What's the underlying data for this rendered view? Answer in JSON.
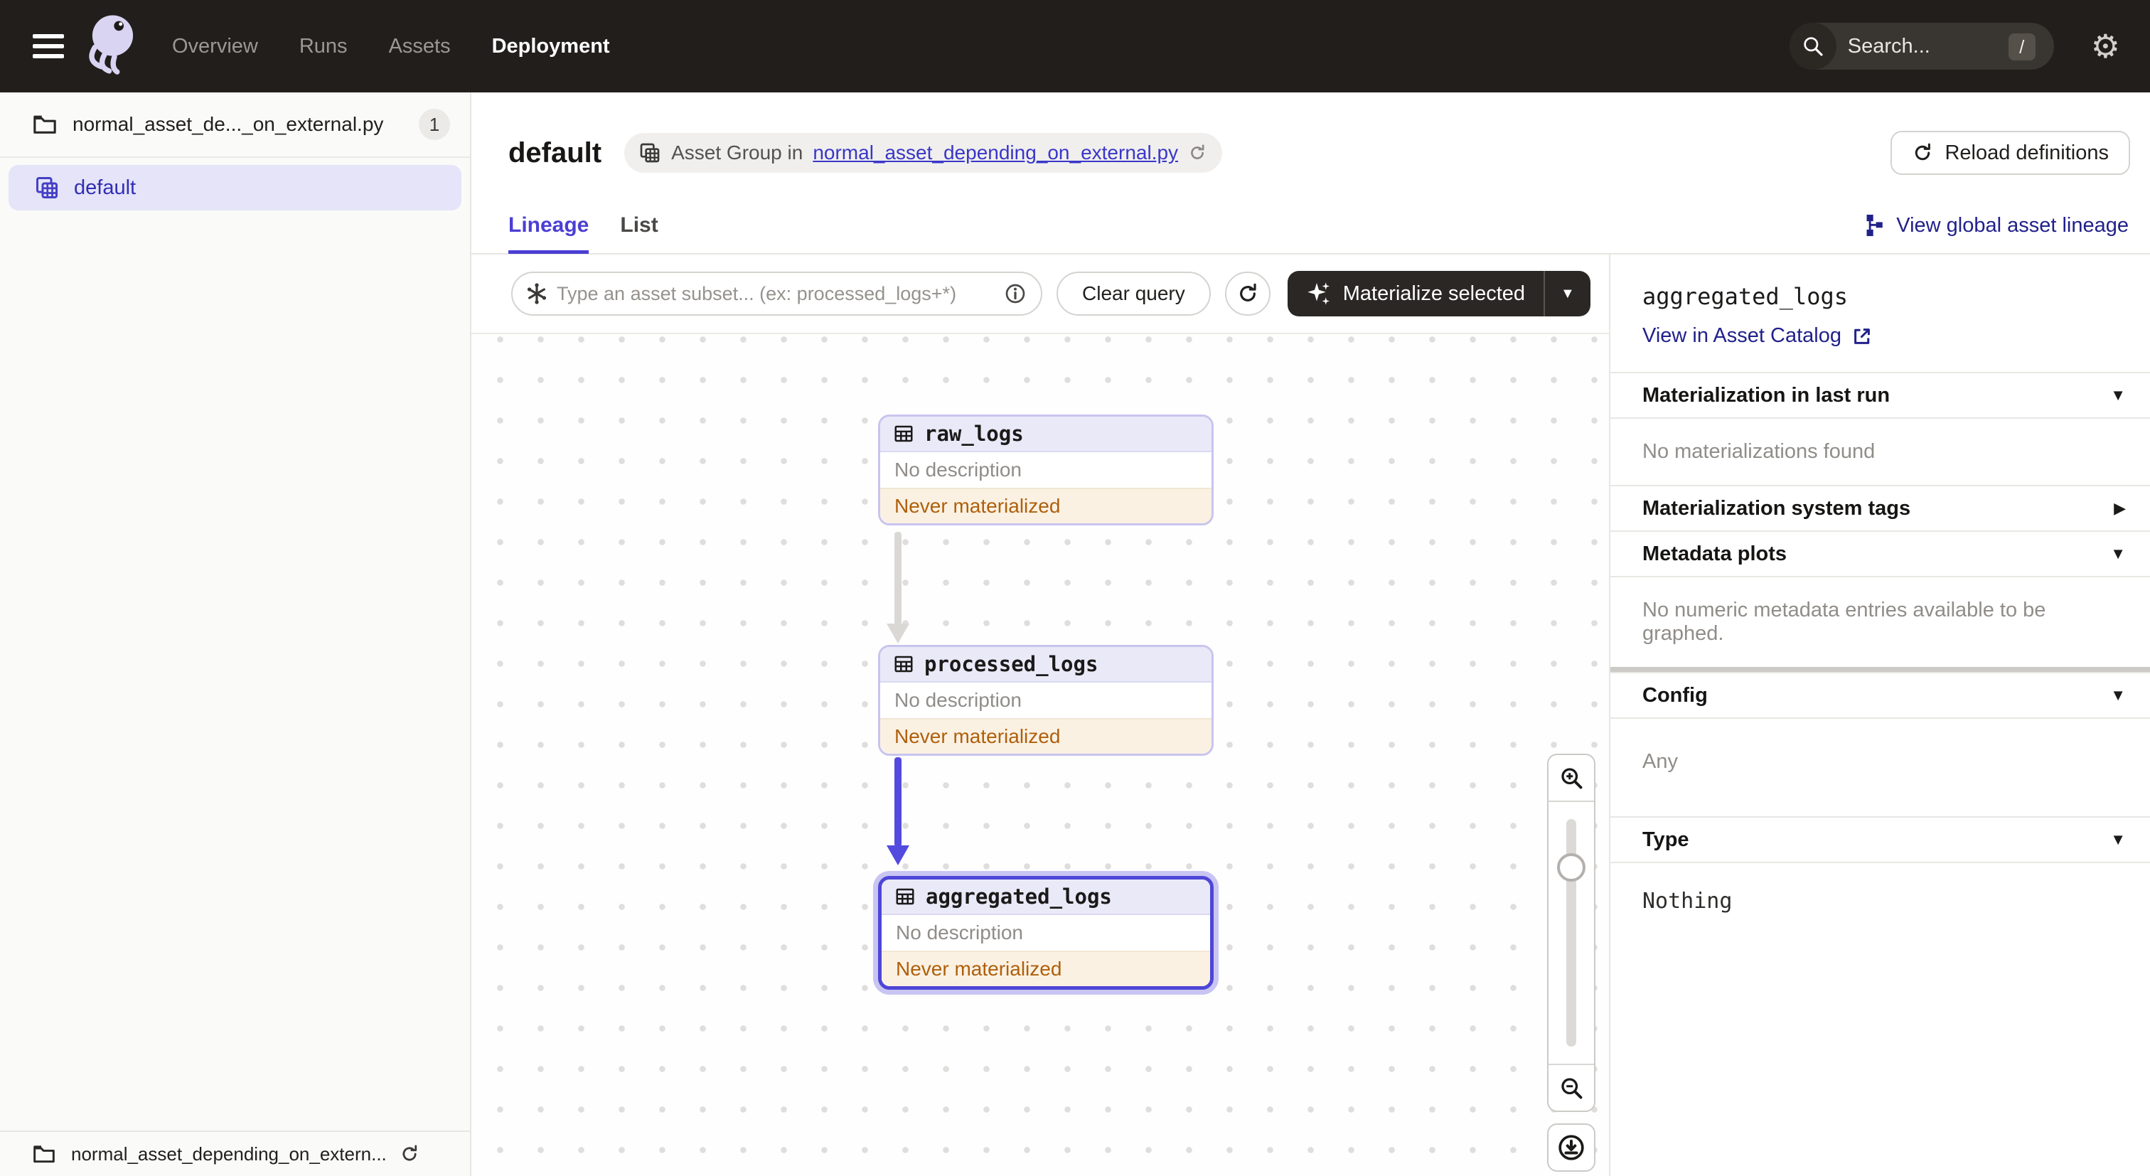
{
  "nav": {
    "links": [
      {
        "label": "Overview"
      },
      {
        "label": "Runs"
      },
      {
        "label": "Assets"
      },
      {
        "label": "Deployment"
      }
    ],
    "active": "Deployment",
    "search": {
      "placeholder": "Search...",
      "shortcut": "/"
    }
  },
  "sidebar": {
    "module": {
      "label": "normal_asset_de..._on_external.py",
      "badge": "1"
    },
    "items": [
      {
        "label": "default",
        "selected": true
      }
    ],
    "footer": {
      "label": "normal_asset_depending_on_extern..."
    }
  },
  "header": {
    "title": "default",
    "breadcrumb": {
      "prefix": "Asset Group in",
      "link": "normal_asset_depending_on_external.py"
    },
    "reload_label": "Reload definitions"
  },
  "tabs": {
    "lineage": "Lineage",
    "list": "List",
    "global_lineage_label": "View global asset lineage"
  },
  "toolbar": {
    "query_placeholder": "Type an asset subset... (ex: processed_logs+*)",
    "clear_label": "Clear query",
    "materialize_label": "Materialize selected"
  },
  "graph": {
    "nodes": [
      {
        "name": "raw_logs",
        "description": "No description",
        "status": "Never materialized",
        "selected": false
      },
      {
        "name": "processed_logs",
        "description": "No description",
        "status": "Never materialized",
        "selected": false
      },
      {
        "name": "aggregated_logs",
        "description": "No description",
        "status": "Never materialized",
        "selected": true
      }
    ],
    "edges": [
      {
        "from": "raw_logs",
        "to": "processed_logs",
        "highlighted": false
      },
      {
        "from": "processed_logs",
        "to": "aggregated_logs",
        "highlighted": true
      }
    ]
  },
  "panel": {
    "title": "aggregated_logs",
    "catalog_link": "View in Asset Catalog",
    "sections": [
      {
        "label": "Materialization in last run",
        "state": "expanded",
        "content": "No materializations found"
      },
      {
        "label": "Materialization system tags",
        "state": "collapsed",
        "content": ""
      },
      {
        "label": "Metadata plots",
        "state": "expanded",
        "content": "No numeric metadata entries available to be graphed."
      },
      {
        "label": "Config",
        "state": "expanded",
        "content": "Any"
      },
      {
        "label": "Type",
        "state": "expanded",
        "content": "Nothing"
      }
    ]
  },
  "colors": {
    "nav_bg": "#211E1C",
    "accent": "#4E46D6",
    "link": "#3A36C9",
    "dark_link": "#21218B",
    "selected_bg": "#E5E4F8",
    "warning_text": "#AF5F0B",
    "warning_bg": "#FBF1E3",
    "edge_gray": "#DAD8D5"
  },
  "glyphs": {
    "caret_down": "▼",
    "caret_right": "▶",
    "gear": "⚙"
  }
}
